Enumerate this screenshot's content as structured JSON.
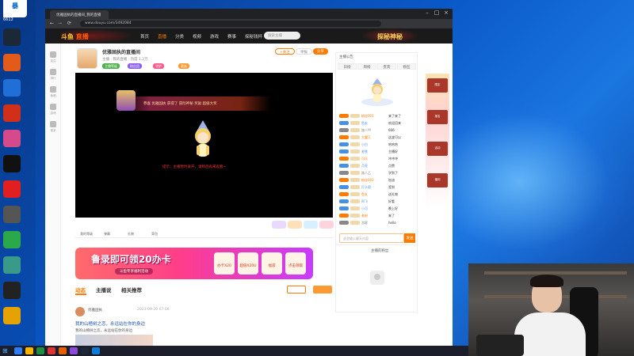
{
  "desktop": {
    "corner_logo": "暴",
    "corner_number": "6612",
    "icons": [
      {
        "name": "steam",
        "color": "#1b2838"
      },
      {
        "name": "app-orange",
        "color": "#e25b1b"
      },
      {
        "name": "app-blue",
        "color": "#1f6fd6"
      },
      {
        "name": "app-red",
        "color": "#d0301a"
      },
      {
        "name": "app-pink",
        "color": "#d44a8a"
      },
      {
        "name": "app-black",
        "color": "#111111"
      },
      {
        "name": "netease-music",
        "color": "#e02020"
      },
      {
        "name": "app-gray",
        "color": "#555555"
      },
      {
        "name": "app-green",
        "color": "#2aa84a"
      },
      {
        "name": "app-teal",
        "color": "#3a9a8a"
      },
      {
        "name": "obs",
        "color": "#222222"
      },
      {
        "name": "app-yellow",
        "color": "#e5a300"
      }
    ]
  },
  "browser": {
    "tab_title": "优雅固执的直播间_我的直播",
    "url": "www.douyu.com/3492084",
    "logo_text": "斗鱼",
    "logo_brand": "直播",
    "topic_banner": "探秘神秘",
    "nav": [
      "首页",
      "直播",
      "分类",
      "视频",
      "游戏",
      "赛事",
      "探秘钱杯"
    ],
    "search_placeholder": "搜索主播",
    "rail": [
      "关注",
      "排行",
      "鱼吧",
      "游戏",
      "更多"
    ]
  },
  "room": {
    "title": "优雅固执的直播间",
    "subtitle": "主播 · 我的直播 · 热度 1.2万",
    "badges": [
      "主播等级",
      "粉丝团",
      "守护",
      "贵族"
    ],
    "follow_label": "+关注",
    "report_label": "举报",
    "share_label": "分享",
    "gift_banner": "恭喜 优雅固执 获得了 冒险神秘 奖励 超级大奖",
    "video_message": "提示：主播暂时离开，请稍后再来观看~",
    "toolbar_items": [
      "我的等级",
      "弹幕",
      "礼物",
      "背包"
    ]
  },
  "promo": {
    "main": "鲁录即可领20办卡",
    "sub": "斗鱼专享福利活动",
    "cards": [
      "办卡X20",
      "超值X20U",
      "福袋",
      "点击领取"
    ]
  },
  "content_tabs": [
    "动态",
    "主播说",
    "相关推荐"
  ],
  "post": {
    "author": "优雅固执",
    "time": "2023-09-20 07:06",
    "title": "我的山楂树之恋，永远站在你的身边",
    "text": "我的山楂树之恋，永远站在你的身边"
  },
  "chat": {
    "header": "主播公告",
    "tabs": [
      "日榜",
      "周榜",
      "贵宾",
      "粉丝"
    ],
    "messages": [
      {
        "nick": "粉丝001",
        "text": "来了来了",
        "color": "#ff7a00"
      },
      {
        "nick": "鱼友",
        "text": "欢迎回来",
        "color": "#4a90e2"
      },
      {
        "nick": "路人甲",
        "text": "666",
        "color": "#888888"
      },
      {
        "nick": "大魔王",
        "text": "这波可以",
        "color": "#ff7a00"
      },
      {
        "nick": "小白",
        "text": "哈哈哈",
        "color": "#4a90e2"
      },
      {
        "nick": "老铁",
        "text": "主播好",
        "color": "#4a90e2"
      },
      {
        "nick": "可乐",
        "text": "冲冲冲",
        "color": "#ff7a00"
      },
      {
        "nick": "月亮",
        "text": "点赞",
        "color": "#4a90e2"
      },
      {
        "nick": "路人乙",
        "text": "学到了",
        "color": "#888888"
      },
      {
        "nick": "粉丝002",
        "text": "加油",
        "color": "#ff7a00"
      },
      {
        "nick": "打卡君",
        "text": "签到",
        "color": "#4a90e2"
      },
      {
        "nick": "鱼丸",
        "text": "送礼物",
        "color": "#ff7a00"
      },
      {
        "nick": "阿飞",
        "text": "好看",
        "color": "#4a90e2"
      },
      {
        "nick": "小可",
        "text": "晚上好",
        "color": "#4a90e2"
      },
      {
        "nick": "老粉",
        "text": "来了",
        "color": "#ff7a00"
      },
      {
        "nick": "游客",
        "text": "hello",
        "color": "#888888"
      }
    ],
    "input_placeholder": "这里输入聊天内容",
    "send_label": "发送",
    "fans_label": "主播的粉丝"
  },
  "ad": {
    "cards": [
      "限定",
      "报名",
      "活动",
      "福利"
    ]
  },
  "taskbar": {
    "start_icon": "windows-icon",
    "apps": [
      "#2d7df6",
      "#f7b500",
      "#1c8e3c",
      "#d33",
      "#e65f00",
      "#8a4bdb",
      "#1b2838",
      "#0f7bd8"
    ]
  }
}
